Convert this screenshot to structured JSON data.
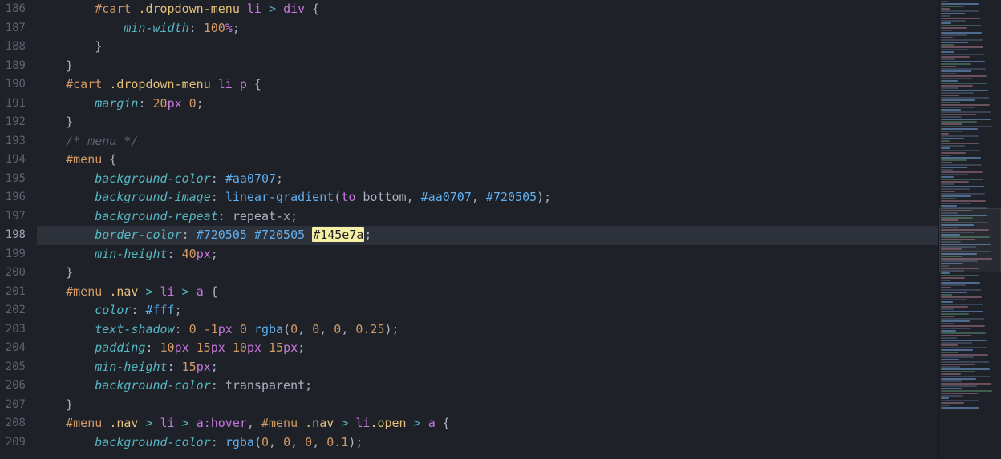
{
  "editor": {
    "current_line_number": 198,
    "lines": [
      {
        "n": 186,
        "indent": 2,
        "tokens": [
          {
            "cls": "tok-id",
            "t": "#cart"
          },
          {
            "cls": "tok-pun",
            "t": " "
          },
          {
            "cls": "tok-cls",
            "t": ".dropdown-menu"
          },
          {
            "cls": "tok-pun",
            "t": " "
          },
          {
            "cls": "tok-tag",
            "t": "li"
          },
          {
            "cls": "tok-pun",
            "t": " "
          },
          {
            "cls": "tok-op",
            "t": ">"
          },
          {
            "cls": "tok-pun",
            "t": " "
          },
          {
            "cls": "tok-tag",
            "t": "div"
          },
          {
            "cls": "tok-pun",
            "t": " {"
          }
        ]
      },
      {
        "n": 187,
        "indent": 3,
        "tokens": [
          {
            "cls": "tok-prop",
            "t": "min-width"
          },
          {
            "cls": "tok-pun",
            "t": ": "
          },
          {
            "cls": "tok-num",
            "t": "100"
          },
          {
            "cls": "tok-unit",
            "t": "%"
          },
          {
            "cls": "tok-pun",
            "t": ";"
          }
        ]
      },
      {
        "n": 188,
        "indent": 2,
        "tokens": [
          {
            "cls": "tok-pun",
            "t": "}"
          }
        ]
      },
      {
        "n": 189,
        "indent": 1,
        "tokens": [
          {
            "cls": "tok-pun",
            "t": "}"
          }
        ]
      },
      {
        "n": 190,
        "indent": 1,
        "tokens": [
          {
            "cls": "tok-id",
            "t": "#cart"
          },
          {
            "cls": "tok-pun",
            "t": " "
          },
          {
            "cls": "tok-cls",
            "t": ".dropdown-menu"
          },
          {
            "cls": "tok-pun",
            "t": " "
          },
          {
            "cls": "tok-tag",
            "t": "li"
          },
          {
            "cls": "tok-pun",
            "t": " "
          },
          {
            "cls": "tok-tag",
            "t": "p"
          },
          {
            "cls": "tok-pun",
            "t": " {"
          }
        ]
      },
      {
        "n": 191,
        "indent": 2,
        "tokens": [
          {
            "cls": "tok-prop",
            "t": "margin"
          },
          {
            "cls": "tok-pun",
            "t": ": "
          },
          {
            "cls": "tok-num",
            "t": "20"
          },
          {
            "cls": "tok-unit",
            "t": "px"
          },
          {
            "cls": "tok-pun",
            "t": " "
          },
          {
            "cls": "tok-num",
            "t": "0"
          },
          {
            "cls": "tok-pun",
            "t": ";"
          }
        ]
      },
      {
        "n": 192,
        "indent": 1,
        "tokens": [
          {
            "cls": "tok-pun",
            "t": "}"
          }
        ]
      },
      {
        "n": 193,
        "indent": 1,
        "tokens": [
          {
            "cls": "tok-cmt",
            "t": "/* menu */"
          }
        ]
      },
      {
        "n": 194,
        "indent": 1,
        "tokens": [
          {
            "cls": "tok-id",
            "t": "#menu"
          },
          {
            "cls": "tok-pun",
            "t": " {"
          }
        ]
      },
      {
        "n": 195,
        "indent": 2,
        "tokens": [
          {
            "cls": "tok-prop",
            "t": "background-color"
          },
          {
            "cls": "tok-pun",
            "t": ": "
          },
          {
            "cls": "tok-hex",
            "t": "#aa0707"
          },
          {
            "cls": "tok-pun",
            "t": ";"
          }
        ]
      },
      {
        "n": 196,
        "indent": 2,
        "tokens": [
          {
            "cls": "tok-prop",
            "t": "background-image"
          },
          {
            "cls": "tok-pun",
            "t": ": "
          },
          {
            "cls": "tok-fn",
            "t": "linear-gradient"
          },
          {
            "cls": "tok-pun",
            "t": "("
          },
          {
            "cls": "tok-kw",
            "t": "to"
          },
          {
            "cls": "tok-pun",
            "t": " "
          },
          {
            "cls": "tok-plain",
            "t": "bottom"
          },
          {
            "cls": "tok-pun",
            "t": ", "
          },
          {
            "cls": "tok-hex",
            "t": "#aa0707"
          },
          {
            "cls": "tok-pun",
            "t": ", "
          },
          {
            "cls": "tok-hex",
            "t": "#720505"
          },
          {
            "cls": "tok-pun",
            "t": ");"
          }
        ]
      },
      {
        "n": 197,
        "indent": 2,
        "tokens": [
          {
            "cls": "tok-prop",
            "t": "background-repeat"
          },
          {
            "cls": "tok-pun",
            "t": ": "
          },
          {
            "cls": "tok-plain",
            "t": "repeat-x"
          },
          {
            "cls": "tok-pun",
            "t": ";"
          }
        ]
      },
      {
        "n": 198,
        "indent": 2,
        "current": true,
        "tokens": [
          {
            "cls": "tok-prop",
            "t": "border-color"
          },
          {
            "cls": "tok-pun",
            "t": ": "
          },
          {
            "cls": "tok-hex",
            "t": "#720505"
          },
          {
            "cls": "tok-pun",
            "t": " "
          },
          {
            "cls": "tok-hex",
            "t": "#720505"
          },
          {
            "cls": "tok-pun",
            "t": " "
          },
          {
            "cls": "highlight",
            "t": "#145e7a"
          },
          {
            "cls": "tok-pun",
            "t": ";"
          }
        ]
      },
      {
        "n": 199,
        "indent": 2,
        "tokens": [
          {
            "cls": "tok-prop",
            "t": "min-height"
          },
          {
            "cls": "tok-pun",
            "t": ": "
          },
          {
            "cls": "tok-num",
            "t": "40"
          },
          {
            "cls": "tok-unit",
            "t": "px"
          },
          {
            "cls": "tok-pun",
            "t": ";"
          }
        ]
      },
      {
        "n": 200,
        "indent": 1,
        "tokens": [
          {
            "cls": "tok-pun",
            "t": "}"
          }
        ]
      },
      {
        "n": 201,
        "indent": 1,
        "tokens": [
          {
            "cls": "tok-id",
            "t": "#menu"
          },
          {
            "cls": "tok-pun",
            "t": " "
          },
          {
            "cls": "tok-cls",
            "t": ".nav"
          },
          {
            "cls": "tok-pun",
            "t": " "
          },
          {
            "cls": "tok-op",
            "t": ">"
          },
          {
            "cls": "tok-pun",
            "t": " "
          },
          {
            "cls": "tok-tag",
            "t": "li"
          },
          {
            "cls": "tok-pun",
            "t": " "
          },
          {
            "cls": "tok-op",
            "t": ">"
          },
          {
            "cls": "tok-pun",
            "t": " "
          },
          {
            "cls": "tok-tag",
            "t": "a"
          },
          {
            "cls": "tok-pun",
            "t": " {"
          }
        ]
      },
      {
        "n": 202,
        "indent": 2,
        "tokens": [
          {
            "cls": "tok-prop",
            "t": "color"
          },
          {
            "cls": "tok-pun",
            "t": ": "
          },
          {
            "cls": "tok-hex",
            "t": "#fff"
          },
          {
            "cls": "tok-pun",
            "t": ";"
          }
        ]
      },
      {
        "n": 203,
        "indent": 2,
        "tokens": [
          {
            "cls": "tok-prop",
            "t": "text-shadow"
          },
          {
            "cls": "tok-pun",
            "t": ": "
          },
          {
            "cls": "tok-num",
            "t": "0"
          },
          {
            "cls": "tok-pun",
            "t": " "
          },
          {
            "cls": "tok-num",
            "t": "-1"
          },
          {
            "cls": "tok-unit",
            "t": "px"
          },
          {
            "cls": "tok-pun",
            "t": " "
          },
          {
            "cls": "tok-num",
            "t": "0"
          },
          {
            "cls": "tok-pun",
            "t": " "
          },
          {
            "cls": "tok-fn",
            "t": "rgba"
          },
          {
            "cls": "tok-pun",
            "t": "("
          },
          {
            "cls": "tok-num",
            "t": "0"
          },
          {
            "cls": "tok-pun",
            "t": ", "
          },
          {
            "cls": "tok-num",
            "t": "0"
          },
          {
            "cls": "tok-pun",
            "t": ", "
          },
          {
            "cls": "tok-num",
            "t": "0"
          },
          {
            "cls": "tok-pun",
            "t": ", "
          },
          {
            "cls": "tok-num",
            "t": "0.25"
          },
          {
            "cls": "tok-pun",
            "t": ");"
          }
        ]
      },
      {
        "n": 204,
        "indent": 2,
        "tokens": [
          {
            "cls": "tok-prop",
            "t": "padding"
          },
          {
            "cls": "tok-pun",
            "t": ": "
          },
          {
            "cls": "tok-num",
            "t": "10"
          },
          {
            "cls": "tok-unit",
            "t": "px"
          },
          {
            "cls": "tok-pun",
            "t": " "
          },
          {
            "cls": "tok-num",
            "t": "15"
          },
          {
            "cls": "tok-unit",
            "t": "px"
          },
          {
            "cls": "tok-pun",
            "t": " "
          },
          {
            "cls": "tok-num",
            "t": "10"
          },
          {
            "cls": "tok-unit",
            "t": "px"
          },
          {
            "cls": "tok-pun",
            "t": " "
          },
          {
            "cls": "tok-num",
            "t": "15"
          },
          {
            "cls": "tok-unit",
            "t": "px"
          },
          {
            "cls": "tok-pun",
            "t": ";"
          }
        ]
      },
      {
        "n": 205,
        "indent": 2,
        "tokens": [
          {
            "cls": "tok-prop",
            "t": "min-height"
          },
          {
            "cls": "tok-pun",
            "t": ": "
          },
          {
            "cls": "tok-num",
            "t": "15"
          },
          {
            "cls": "tok-unit",
            "t": "px"
          },
          {
            "cls": "tok-pun",
            "t": ";"
          }
        ]
      },
      {
        "n": 206,
        "indent": 2,
        "tokens": [
          {
            "cls": "tok-prop",
            "t": "background-color"
          },
          {
            "cls": "tok-pun",
            "t": ": "
          },
          {
            "cls": "tok-plain",
            "t": "transparent"
          },
          {
            "cls": "tok-pun",
            "t": ";"
          }
        ]
      },
      {
        "n": 207,
        "indent": 1,
        "tokens": [
          {
            "cls": "tok-pun",
            "t": "}"
          }
        ]
      },
      {
        "n": 208,
        "indent": 1,
        "tokens": [
          {
            "cls": "tok-id",
            "t": "#menu"
          },
          {
            "cls": "tok-pun",
            "t": " "
          },
          {
            "cls": "tok-cls",
            "t": ".nav"
          },
          {
            "cls": "tok-pun",
            "t": " "
          },
          {
            "cls": "tok-op",
            "t": ">"
          },
          {
            "cls": "tok-pun",
            "t": " "
          },
          {
            "cls": "tok-tag",
            "t": "li"
          },
          {
            "cls": "tok-pun",
            "t": " "
          },
          {
            "cls": "tok-op",
            "t": ">"
          },
          {
            "cls": "tok-pun",
            "t": " "
          },
          {
            "cls": "tok-tag",
            "t": "a"
          },
          {
            "cls": "tok-pseudo",
            "t": ":hover"
          },
          {
            "cls": "tok-pun",
            "t": ", "
          },
          {
            "cls": "tok-id",
            "t": "#menu"
          },
          {
            "cls": "tok-pun",
            "t": " "
          },
          {
            "cls": "tok-cls",
            "t": ".nav"
          },
          {
            "cls": "tok-pun",
            "t": " "
          },
          {
            "cls": "tok-op",
            "t": ">"
          },
          {
            "cls": "tok-pun",
            "t": " "
          },
          {
            "cls": "tok-tag",
            "t": "li"
          },
          {
            "cls": "tok-cls",
            "t": ".open"
          },
          {
            "cls": "tok-pun",
            "t": " "
          },
          {
            "cls": "tok-op",
            "t": ">"
          },
          {
            "cls": "tok-pun",
            "t": " "
          },
          {
            "cls": "tok-tag",
            "t": "a"
          },
          {
            "cls": "tok-pun",
            "t": " {"
          }
        ]
      },
      {
        "n": 209,
        "indent": 2,
        "tokens": [
          {
            "cls": "tok-prop",
            "t": "background-color"
          },
          {
            "cls": "tok-pun",
            "t": ": "
          },
          {
            "cls": "tok-fn",
            "t": "rgba"
          },
          {
            "cls": "tok-pun",
            "t": "("
          },
          {
            "cls": "tok-num",
            "t": "0"
          },
          {
            "cls": "tok-pun",
            "t": ", "
          },
          {
            "cls": "tok-num",
            "t": "0"
          },
          {
            "cls": "tok-pun",
            "t": ", "
          },
          {
            "cls": "tok-num",
            "t": "0"
          },
          {
            "cls": "tok-pun",
            "t": ", "
          },
          {
            "cls": "tok-num",
            "t": "0.1"
          },
          {
            "cls": "tok-pun",
            "t": ");"
          }
        ]
      }
    ]
  },
  "minimap": {
    "line_count": 170
  }
}
